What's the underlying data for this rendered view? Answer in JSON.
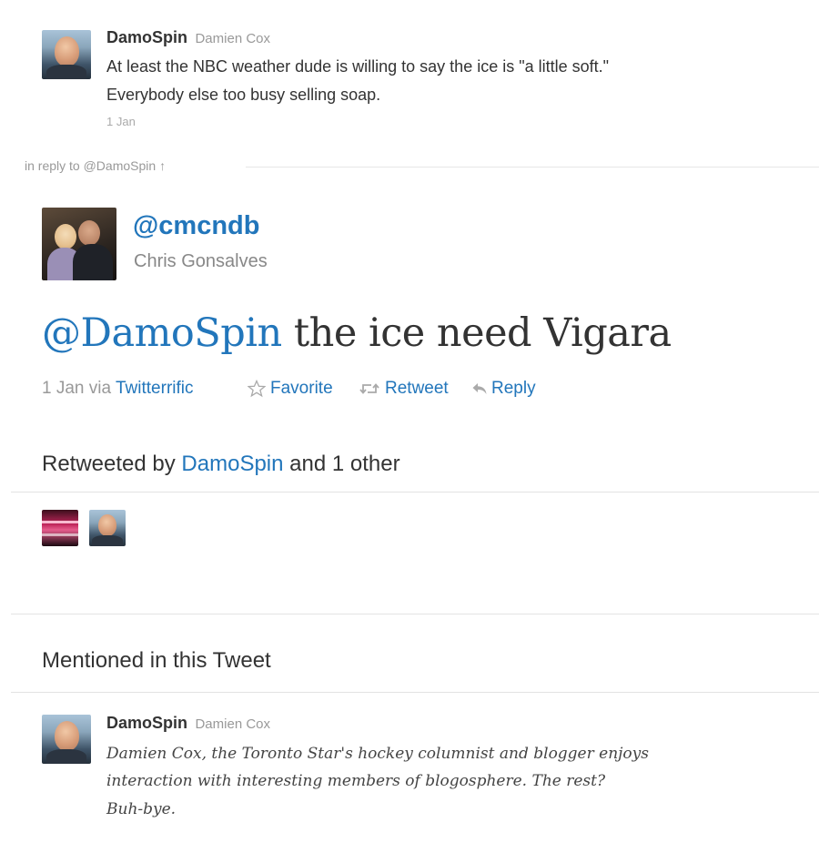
{
  "parent_tweet": {
    "username": "DamoSpin",
    "fullname": "Damien Cox",
    "text_line1": "At least the NBC weather dude is willing to say the ice is \"a little soft.\"",
    "text_line2": "Everybody else too busy selling soap.",
    "timestamp": "1 Jan"
  },
  "in_reply_to": {
    "label": "in reply to @DamoSpin",
    "arrow": "↑"
  },
  "main_tweet": {
    "handle": "@cmcndb",
    "fullname": "Chris Gonsalves",
    "mention": "@DamoSpin",
    "text_rest": " the ice need Vigara",
    "timestamp": "1 Jan",
    "via_label": "via",
    "client": "Twitterrific",
    "actions": {
      "favorite": "Favorite",
      "retweet": "Retweet",
      "reply": "Reply"
    }
  },
  "retweeted_by": {
    "prefix": "Retweeted by ",
    "user": "DamoSpin",
    "suffix": " and 1 other"
  },
  "mentioned": {
    "heading": "Mentioned in this Tweet",
    "username": "DamoSpin",
    "fullname": "Damien Cox",
    "bio_line1": "Damien Cox, the Toronto Star's hockey columnist and blogger enjoys",
    "bio_line2": "interaction with interesting members of blogosphere. The rest?",
    "bio_line3": "Buh-bye."
  },
  "colors": {
    "link": "#2276bb",
    "text": "#333333",
    "muted": "#999999"
  },
  "icons": [
    "star-icon",
    "retweet-icon",
    "reply-icon",
    "up-arrow-icon"
  ]
}
